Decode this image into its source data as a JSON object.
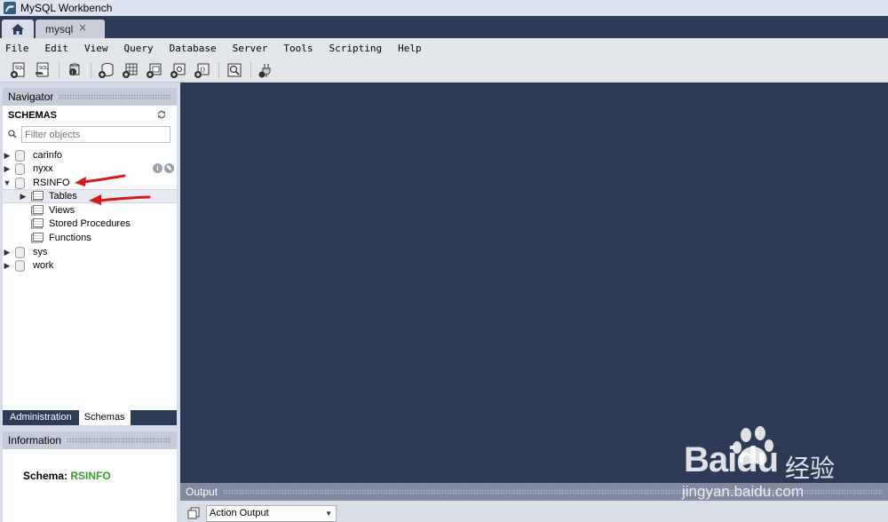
{
  "window": {
    "title": "MySQL Workbench"
  },
  "tabs": {
    "connection_label": "mysql",
    "close_glyph": "×"
  },
  "menu": [
    "File",
    "Edit",
    "View",
    "Query",
    "Database",
    "Server",
    "Tools",
    "Scripting",
    "Help"
  ],
  "toolbar_icons": [
    "new-sql-tab-icon",
    "open-sql-script-icon",
    "inspector-icon",
    "create-schema-icon",
    "create-table-icon",
    "create-view-icon",
    "create-procedure-icon",
    "create-function-icon",
    "search-table-data-icon",
    "reconnect-icon"
  ],
  "navigator": {
    "header": "Navigator",
    "schemas_label": "SCHEMAS",
    "filter_placeholder": "Filter objects",
    "tree": [
      {
        "label": "carinfo",
        "expanded": false
      },
      {
        "label": "nyxx",
        "expanded": false
      },
      {
        "label": "RSINFO",
        "expanded": true,
        "children": [
          "Tables",
          "Views",
          "Stored Procedures",
          "Functions"
        ]
      },
      {
        "label": "sys",
        "expanded": false
      },
      {
        "label": "work",
        "expanded": false
      }
    ],
    "row_action_glyphs": [
      "i",
      "✎"
    ]
  },
  "side_tabs": {
    "administration": "Administration",
    "schemas": "Schemas",
    "active": "Schemas"
  },
  "information": {
    "header": "Information",
    "schema_label": "Schema:",
    "schema_value": "RSINFO"
  },
  "output": {
    "header": "Output",
    "selected_option": "Action Output"
  },
  "watermark": {
    "brand": "Bai",
    "brand_tail": "du",
    "cn": "经验",
    "url": "jingyan.baidu.com"
  },
  "colors": {
    "editor_bg": "#2c3a55",
    "tabstrip_bg": "#2c3b56",
    "panel_header": "#c5ccd8",
    "schema_value": "#3a9a2a",
    "annotation": "#d7191c"
  }
}
